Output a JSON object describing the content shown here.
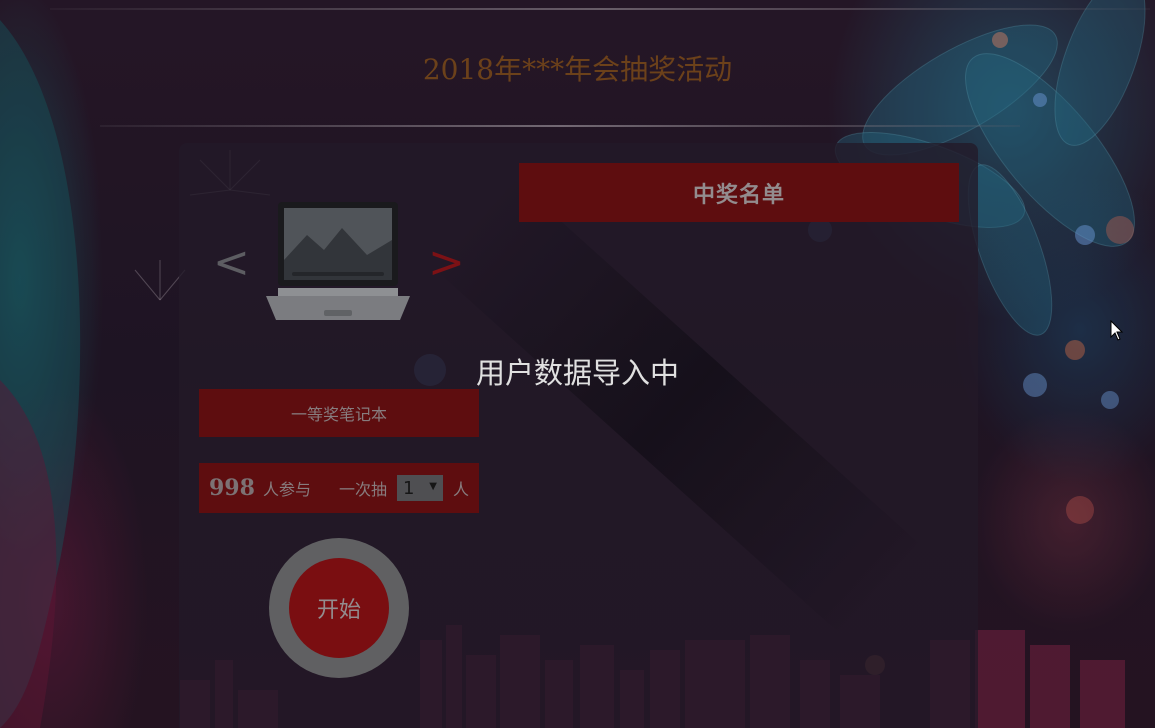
{
  "header": {
    "title": "2018年***年会抽奖活动"
  },
  "winners": {
    "header_label": "中奖名单"
  },
  "prize": {
    "prev_arrow": "<",
    "next_arrow": ">",
    "image_icon": "laptop-icon",
    "label": "一等奖笔记本"
  },
  "loading": {
    "message": "用户数据导入中"
  },
  "participants": {
    "count": "998",
    "count_unit": "人参与",
    "draw_label": "一次抽",
    "draw_value": "1",
    "draw_unit": "人"
  },
  "start": {
    "label": "开始"
  },
  "colors": {
    "accent_red": "#6b0f12",
    "button_red": "#8b1014",
    "title_brown": "#7c4a1e"
  }
}
